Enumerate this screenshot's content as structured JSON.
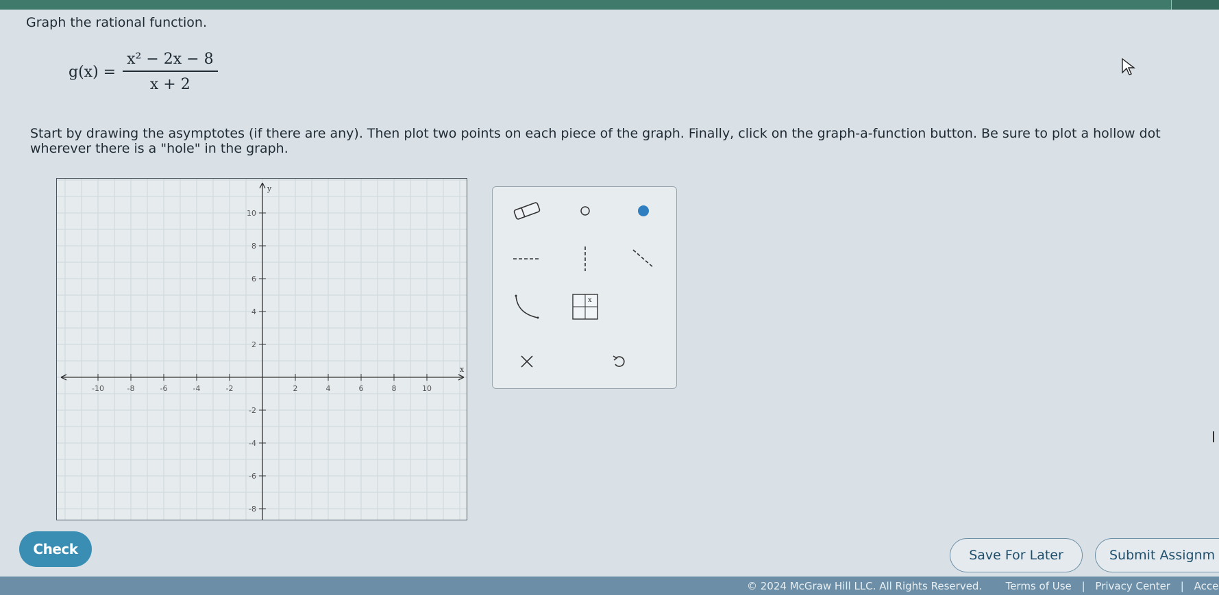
{
  "problem": {
    "prompt": "Graph the rational function.",
    "function_lhs": "g(x) =",
    "numerator": "x² − 2x − 8",
    "denominator": "x + 2",
    "instructions": "Start by drawing the asymptotes (if there are any). Then plot two points on each piece of the graph. Finally, click on the graph-a-function button. Be sure to plot a hollow dot wherever there is a \"hole\" in the graph."
  },
  "graph": {
    "x_axis_label": "x",
    "y_axis_label": "y",
    "x_tick_labels": [
      "-10",
      "-8",
      "-6",
      "-4",
      "-2",
      "2",
      "4",
      "6",
      "8",
      "10"
    ],
    "y_tick_labels": [
      "10",
      "8",
      "6",
      "4",
      "2",
      "-2",
      "-4",
      "-6",
      "-8"
    ],
    "x_range": [
      -10,
      10
    ],
    "y_range": [
      -10,
      10
    ],
    "grid": true
  },
  "toolbox": {
    "tools": [
      {
        "name": "eraser-tool"
      },
      {
        "name": "hollow-dot-tool"
      },
      {
        "name": "solid-dot-tool"
      },
      {
        "name": "horizontal-asymptote-tool"
      },
      {
        "name": "vertical-asymptote-tool"
      },
      {
        "name": "oblique-asymptote-tool"
      },
      {
        "name": "graph-a-function-tool"
      },
      {
        "name": "function-plot-tool"
      },
      {
        "name": "clear-tool"
      },
      {
        "name": "undo-tool"
      }
    ]
  },
  "actions": {
    "check_label": "Check",
    "save_label": "Save For Later",
    "submit_label": "Submit Assignm"
  },
  "footer": {
    "copyright": "© 2024 McGraw Hill LLC. All Rights Reserved.",
    "terms": "Terms of Use",
    "privacy": "Privacy Center",
    "access": "Acces"
  },
  "colors": {
    "primary_button": "#3b8eb3",
    "footer_bg": "#6c8ea6",
    "top_bar": "#3f7a6a",
    "solid_dot": "#2f7fc0"
  }
}
